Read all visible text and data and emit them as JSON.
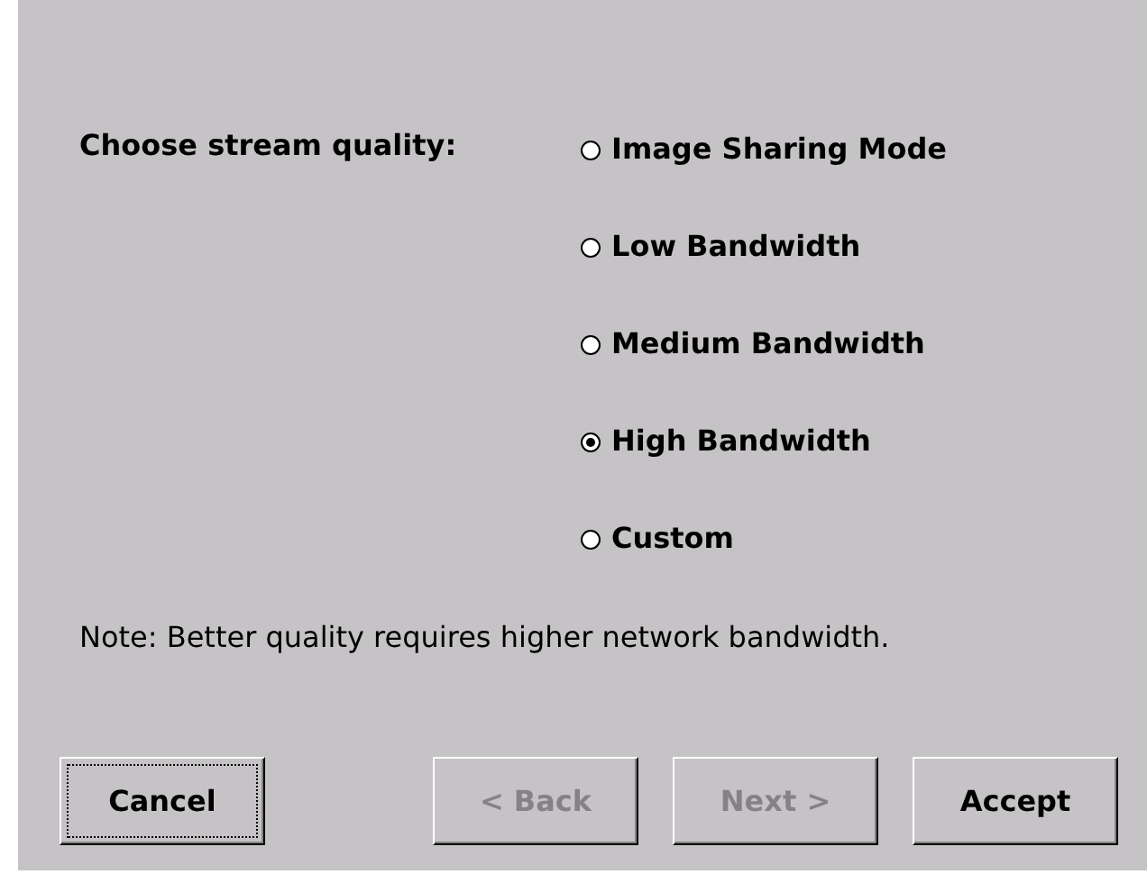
{
  "prompt": "Choose stream quality:",
  "options": [
    {
      "label": "Image Sharing Mode",
      "selected": false
    },
    {
      "label": "Low Bandwidth",
      "selected": false
    },
    {
      "label": "Medium Bandwidth",
      "selected": false
    },
    {
      "label": "High Bandwidth",
      "selected": true
    },
    {
      "label": "Custom",
      "selected": false
    }
  ],
  "note": "Note: Better quality requires higher network bandwidth.",
  "buttons": [
    {
      "label": "Cancel",
      "disabled": false,
      "focused": true
    },
    {
      "label": "< Back",
      "disabled": true,
      "focused": false
    },
    {
      "label": "Next >",
      "disabled": true,
      "focused": false
    },
    {
      "label": "Accept",
      "disabled": false,
      "focused": false
    }
  ]
}
